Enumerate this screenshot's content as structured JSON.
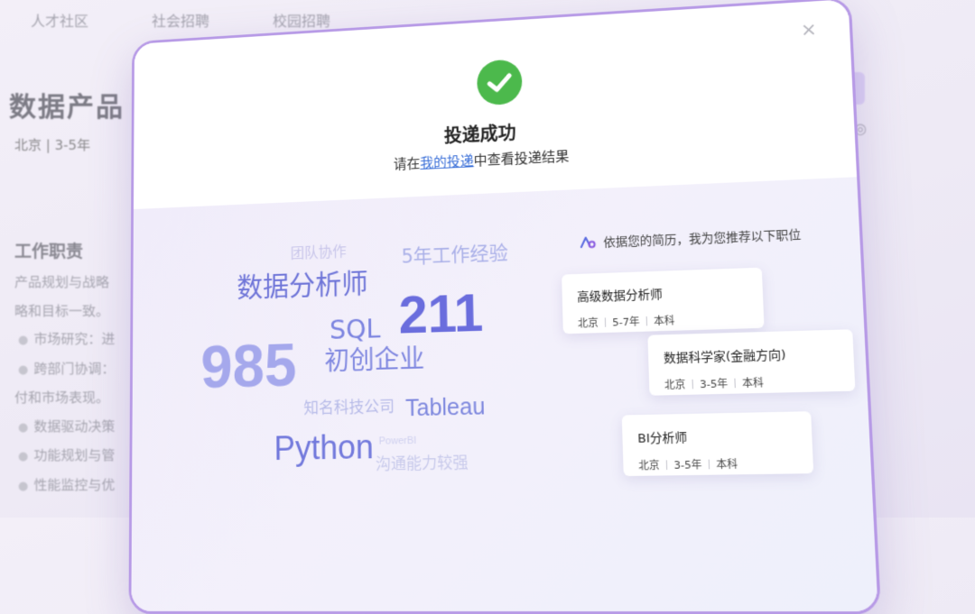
{
  "background": {
    "nav": [
      "人才社区",
      "社会招聘",
      "校园招聘"
    ],
    "title": "数据产品",
    "meta": "北京 | 3-5年",
    "section_title": "工作职责",
    "lines": [
      {
        "text": "产品规划与战略",
        "bullet": false
      },
      {
        "text": "略和目标一致。",
        "bullet": false
      },
      {
        "text": "市场研究：进",
        "bullet": true
      },
      {
        "text": "跨部门协调：",
        "bullet": true
      },
      {
        "text": "付和市场表现。",
        "bullet": false
      },
      {
        "text": "数据驱动决策",
        "bullet": true
      },
      {
        "text": "功能规划与管",
        "bullet": true
      },
      {
        "text": "性能监控与优",
        "bullet": true
      }
    ]
  },
  "modal": {
    "close": "×",
    "title": "投递成功",
    "subtitle_prefix": "请在",
    "subtitle_link": "我的投递",
    "subtitle_suffix": "中查看投递结果",
    "success_color": "#4cb94c",
    "link_color": "#3a6fd8"
  },
  "word_cloud": [
    "团队协作",
    "5年工作经验",
    "数据分析师",
    "SQL",
    "211",
    "985",
    "初创企业",
    "知名科技公司",
    "Tableau",
    "Python",
    "PowerBI",
    "沟通能力较强"
  ],
  "recommend": {
    "header": "依据您的简历，我为您推荐以下职位",
    "icon": "ai-sparkle-icon",
    "jobs": [
      {
        "title": "高级数据分析师",
        "city": "北京",
        "exp": "5-7年",
        "edu": "本科"
      },
      {
        "title": "数据科学家(金融方向)",
        "city": "北京",
        "exp": "3-5年",
        "edu": "本科"
      },
      {
        "title": "BI分析师",
        "city": "北京",
        "exp": "3-5年",
        "edu": "本科"
      }
    ]
  }
}
